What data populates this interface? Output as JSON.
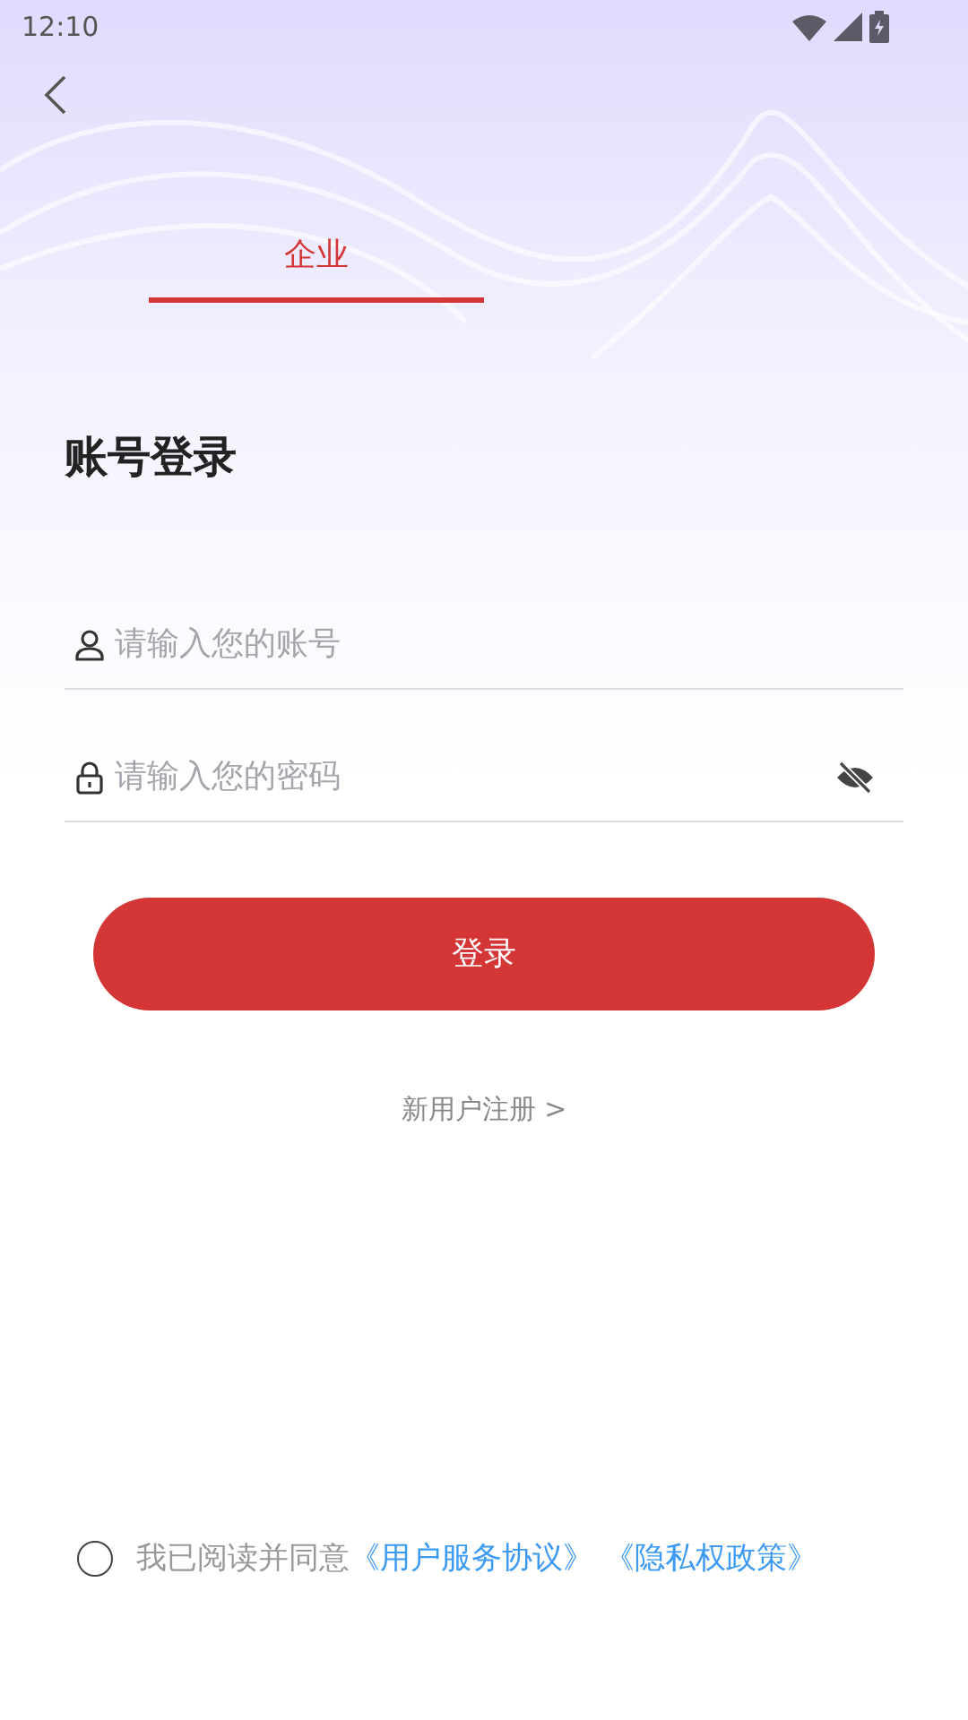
{
  "status_bar": {
    "time": "12:10"
  },
  "tabs": [
    {
      "label": "企业",
      "selected": true
    }
  ],
  "title": "账号登录",
  "fields": [
    {
      "kind": "account",
      "placeholder": "请输入您的账号"
    },
    {
      "kind": "password",
      "placeholder": "请输入您的密码",
      "password_visible": false
    }
  ],
  "login_button": "登录",
  "register_link": "新用户注册 >",
  "agreement": {
    "checked": false,
    "text": "我已阅读并同意",
    "links": [
      "《用户服务协议》",
      "《隐私权政策》"
    ]
  }
}
